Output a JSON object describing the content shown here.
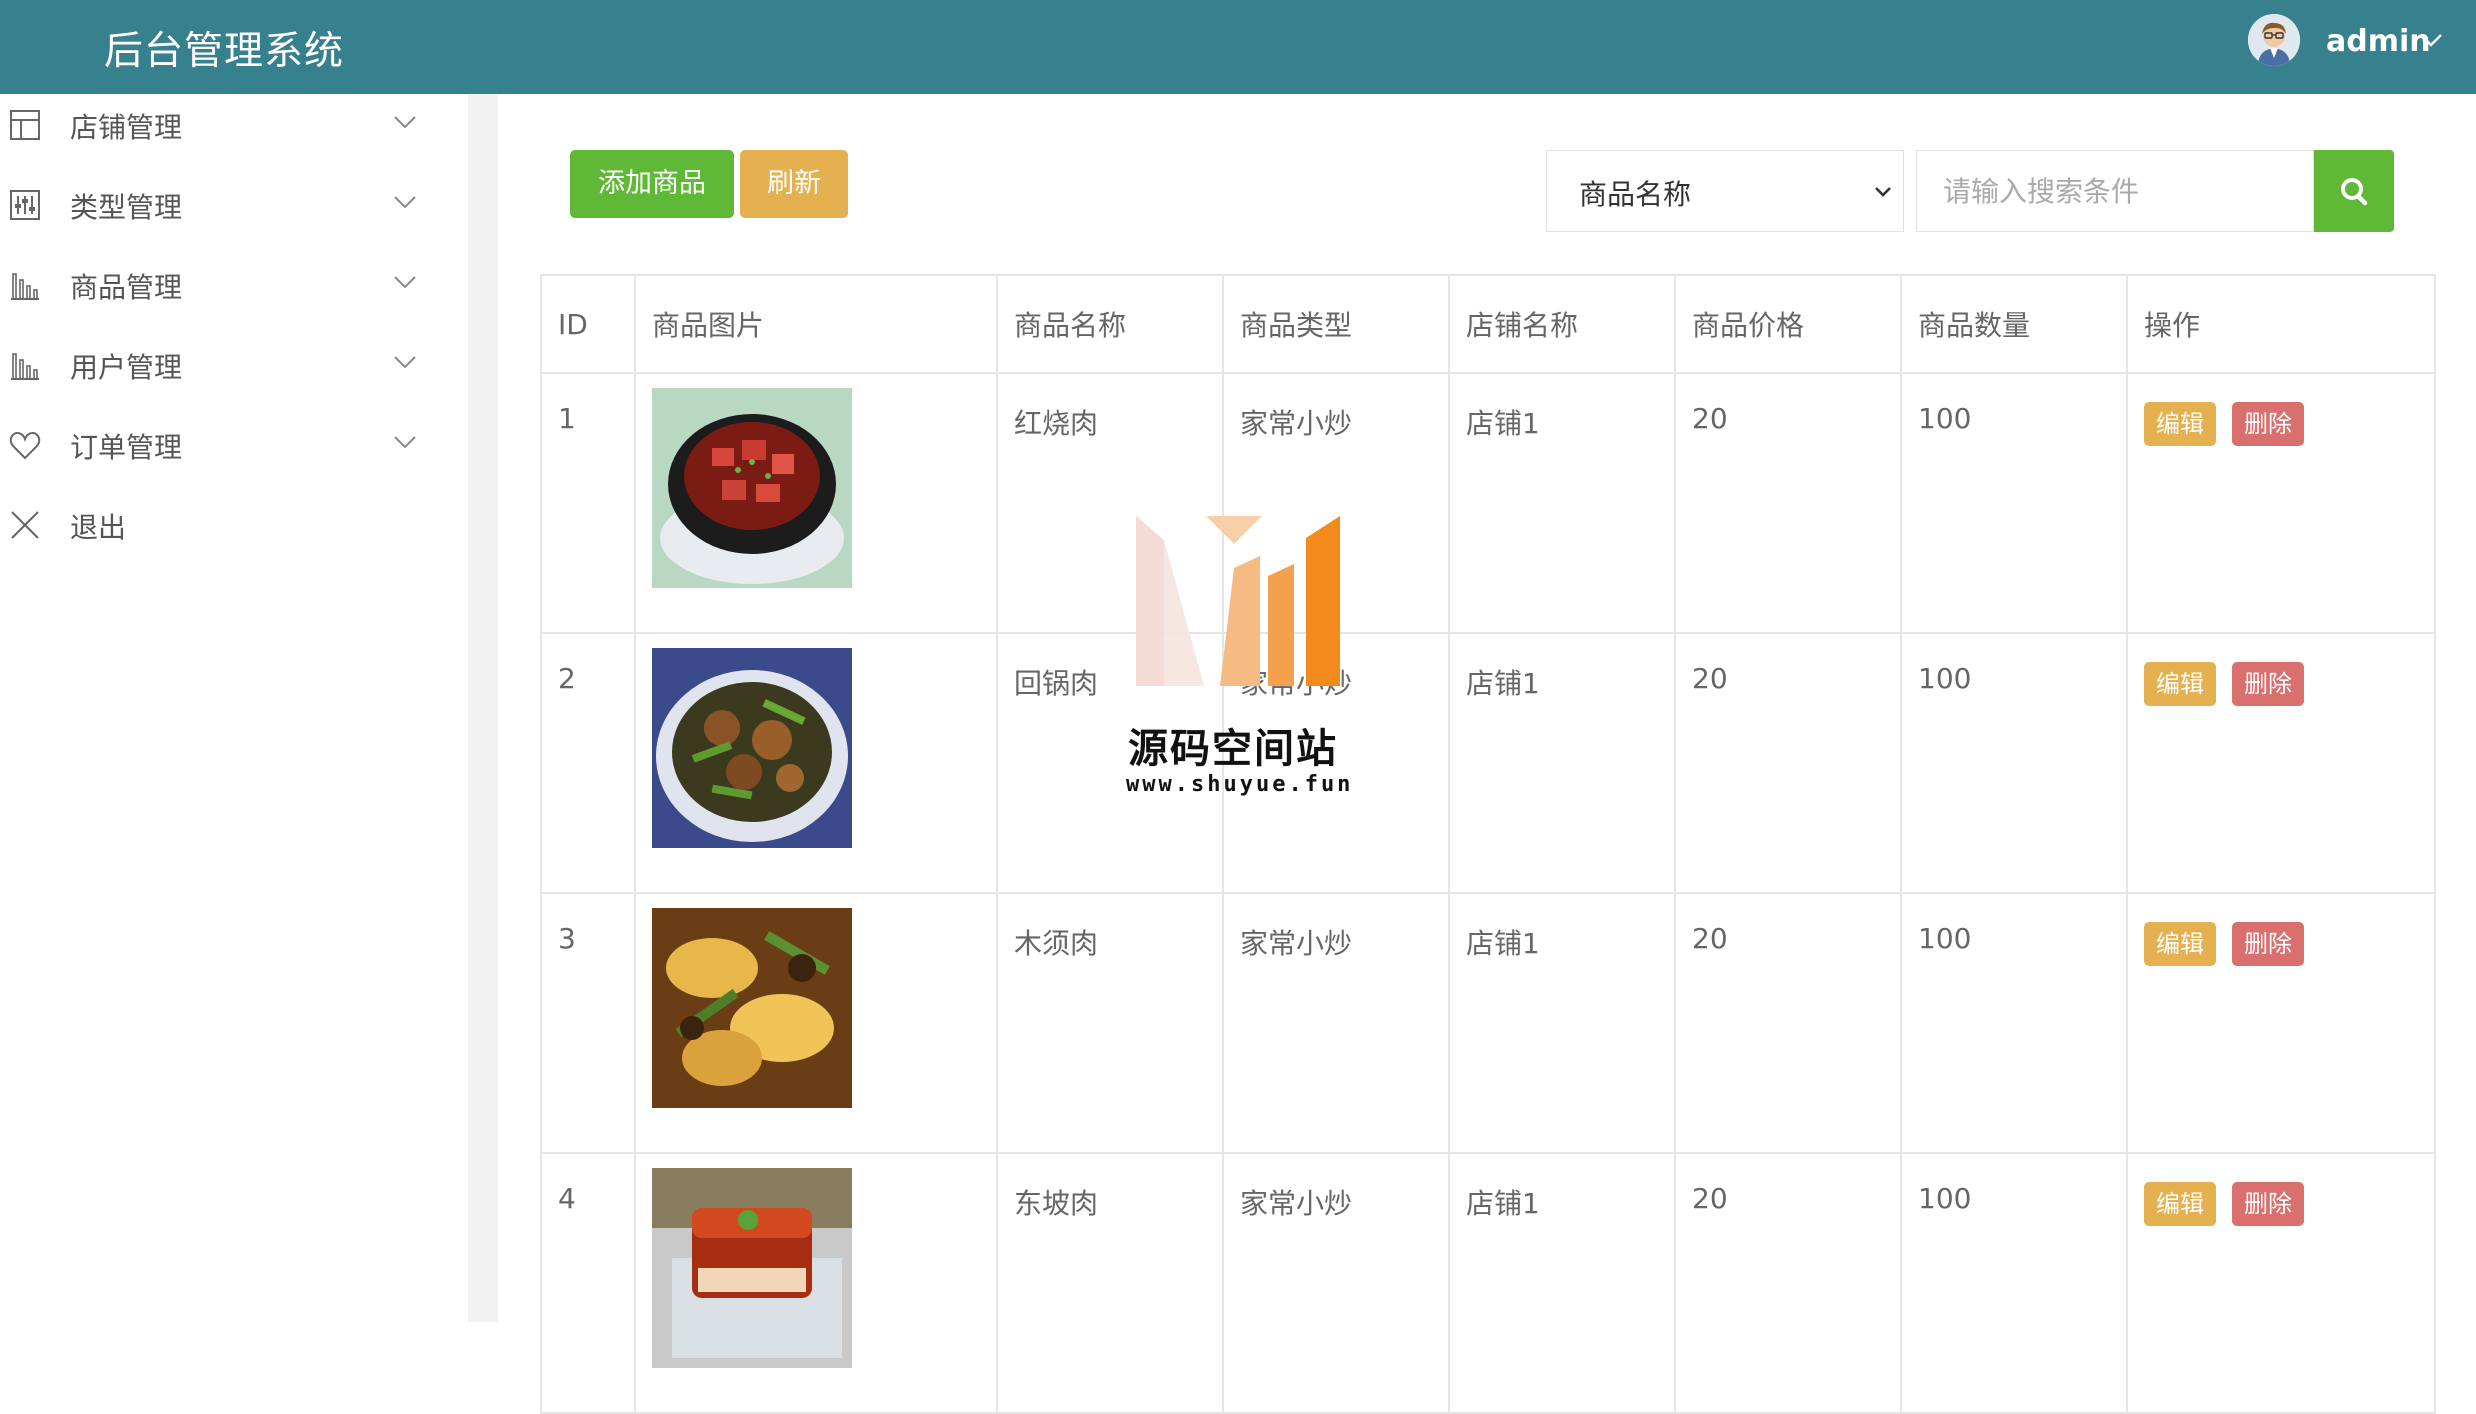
{
  "header": {
    "title": "后台管理系统",
    "user": "admin"
  },
  "sidebar": {
    "items": [
      {
        "label": "店铺管理",
        "icon": "layout-icon"
      },
      {
        "label": "类型管理",
        "icon": "sliders-icon"
      },
      {
        "label": "商品管理",
        "icon": "bar-chart-icon"
      },
      {
        "label": "用户管理",
        "icon": "bar-chart-icon"
      },
      {
        "label": "订单管理",
        "icon": "heart-icon"
      },
      {
        "label": "退出",
        "icon": "close-icon"
      }
    ]
  },
  "toolbar": {
    "add_label": "添加商品",
    "refresh_label": "刷新",
    "search_field": "商品名称",
    "search_placeholder": "请输入搜索条件"
  },
  "table": {
    "headers": [
      "ID",
      "商品图片",
      "商品名称",
      "商品类型",
      "店铺名称",
      "商品价格",
      "商品数量",
      "操作"
    ],
    "rows": [
      {
        "id": "1",
        "name": "红烧肉",
        "type": "家常小炒",
        "shop": "店铺1",
        "price": "20",
        "qty": "100"
      },
      {
        "id": "2",
        "name": "回锅肉",
        "type": "家常小炒",
        "shop": "店铺1",
        "price": "20",
        "qty": "100"
      },
      {
        "id": "3",
        "name": "木须肉",
        "type": "家常小炒",
        "shop": "店铺1",
        "price": "20",
        "qty": "100"
      },
      {
        "id": "4",
        "name": "东坡肉",
        "type": "家常小炒",
        "shop": "店铺1",
        "price": "20",
        "qty": "100"
      }
    ],
    "edit_label": "编辑",
    "delete_label": "删除"
  },
  "watermark": {
    "title": "源码空间站",
    "url": "www.shuyue.fun"
  },
  "colors": {
    "header": "#37808d",
    "primary": "#5fb936",
    "warning": "#e5b150",
    "danger": "#d9706d"
  }
}
